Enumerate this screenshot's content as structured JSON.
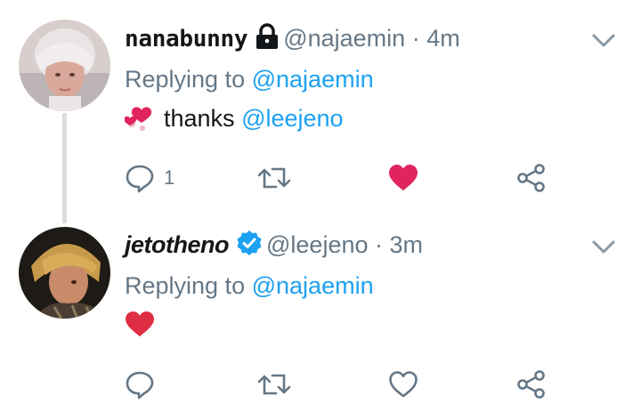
{
  "tweets": [
    {
      "display_name": "nanabunny",
      "handle": "@najaemin",
      "dot": "·",
      "time": "4m",
      "replying_prefix": "Replying to",
      "replying_handle": "@najaemin",
      "body_text": "thanks",
      "body_mention": "@leejeno",
      "badge_icon": "lock-icon",
      "reply_count": "1",
      "liked": true
    },
    {
      "display_name": "jetotheno",
      "handle": "@leejeno",
      "dot": "·",
      "time": "3m",
      "replying_prefix": "Replying to",
      "replying_handle": "@najaemin",
      "body_text": "",
      "body_mention": "",
      "badge_icon": "verified-icon",
      "reply_count": "",
      "liked": false
    }
  ],
  "colors": {
    "text_primary": "#14171a",
    "text_secondary": "#657786",
    "link": "#1da1f2",
    "like_active": "#e0245e",
    "thread_line": "#d9dde1",
    "verified": "#1da1f2"
  }
}
